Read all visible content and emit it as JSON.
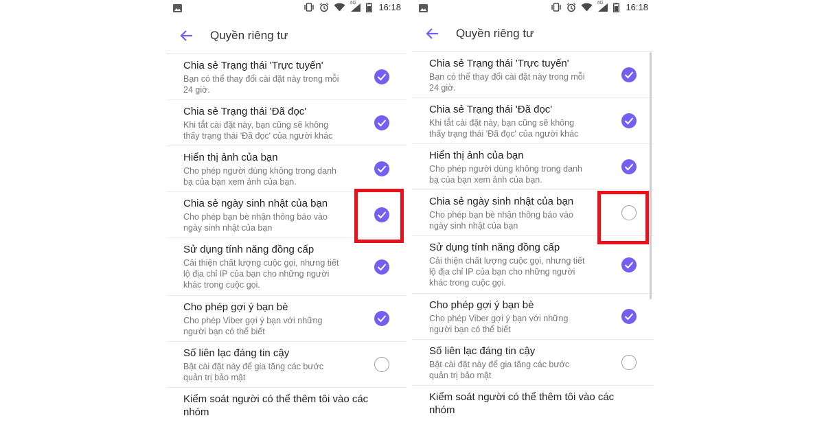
{
  "status_bar": {
    "time": "16:18",
    "network": "4G"
  },
  "header": {
    "title": "Quyền riêng tư",
    "back_icon": "arrow-left-icon"
  },
  "accent_color": "#7360f2",
  "highlight_color": "#e8111c",
  "screens": [
    {
      "items": [
        {
          "title": "Chia sẻ Trạng thái 'Trực tuyến'",
          "desc": [
            "Bạn có thể thay đổi cài đặt này trong mỗi",
            "24 giờ."
          ],
          "checked": true
        },
        {
          "title": "Chia sẻ Trạng thái 'Đã đọc'",
          "desc": [
            "Khi tắt cài đặt này, bạn cũng sẽ không",
            "thấy trạng thái 'Đã đọc' của người khác"
          ],
          "checked": true
        },
        {
          "title": "Hiển thị ảnh của bạn",
          "desc": [
            "Cho phép người dùng không trong danh",
            "bạ của bạn xem ảnh của bạn."
          ],
          "checked": true
        },
        {
          "title": "Chia sẻ ngày sinh nhật của bạn",
          "desc": [
            "Cho phép bạn bè nhận thông báo vào",
            "ngày sinh nhật của bạn"
          ],
          "checked": true
        },
        {
          "title": "Sử dụng tính năng đồng cấp",
          "desc": [
            "Cải thiện chất lượng cuộc gọi, nhưng tiết",
            "lộ địa chỉ IP của bạn cho những người",
            "khác trong cuộc gọi."
          ],
          "checked": true
        },
        {
          "title": "Cho phép gợi ý bạn bè",
          "desc": [
            "Cho phép Viber gợi ý bạn với những",
            "người bạn có thể biết"
          ],
          "checked": true
        },
        {
          "title": "Số liên lạc đáng tin cậy",
          "desc": [
            "Bật cài đặt này để gia tăng các bước",
            "quản trị bảo mật"
          ],
          "checked": false
        },
        {
          "title": "Kiểm soát người có thể thêm tôi vào các nhóm",
          "desc": [],
          "checked": null
        }
      ]
    },
    {
      "items": [
        {
          "title": "Chia sẻ Trạng thái 'Trực tuyến'",
          "desc": [
            "Bạn có thể thay đổi cài đặt này trong mỗi",
            "24 giờ."
          ],
          "checked": true
        },
        {
          "title": "Chia sẻ Trạng thái 'Đã đọc'",
          "desc": [
            "Khi tắt cài đặt này, bạn cũng sẽ không",
            "thấy trạng thái 'Đã đọc' của người khác"
          ],
          "checked": true
        },
        {
          "title": "Hiển thị ảnh của bạn",
          "desc": [
            "Cho phép người dùng không trong danh",
            "bạ của bạn xem ảnh của bạn."
          ],
          "checked": true
        },
        {
          "title": "Chia sẻ ngày sinh nhật của bạn",
          "desc": [
            "Cho phép bạn bè nhận thông báo vào",
            "ngày sinh nhật của bạn"
          ],
          "checked": false
        },
        {
          "title": "Sử dụng tính năng đồng cấp",
          "desc": [
            "Cải thiện chất lượng cuộc gọi, nhưng tiết",
            "lộ địa chỉ IP của bạn cho những người",
            "khác trong cuộc gọi."
          ],
          "checked": true
        },
        {
          "title": "Cho phép gợi ý bạn bè",
          "desc": [
            "Cho phép Viber gợi ý bạn với những",
            "người bạn có thể biết"
          ],
          "checked": true
        },
        {
          "title": "Số liên lạc đáng tin cậy",
          "desc": [
            "Bật cài đặt này để gia tăng các bước",
            "quản trị bảo mật"
          ],
          "checked": false
        },
        {
          "title": "Kiểm soát người có thể thêm tôi vào các nhóm",
          "desc": [],
          "checked": null
        }
      ]
    }
  ]
}
